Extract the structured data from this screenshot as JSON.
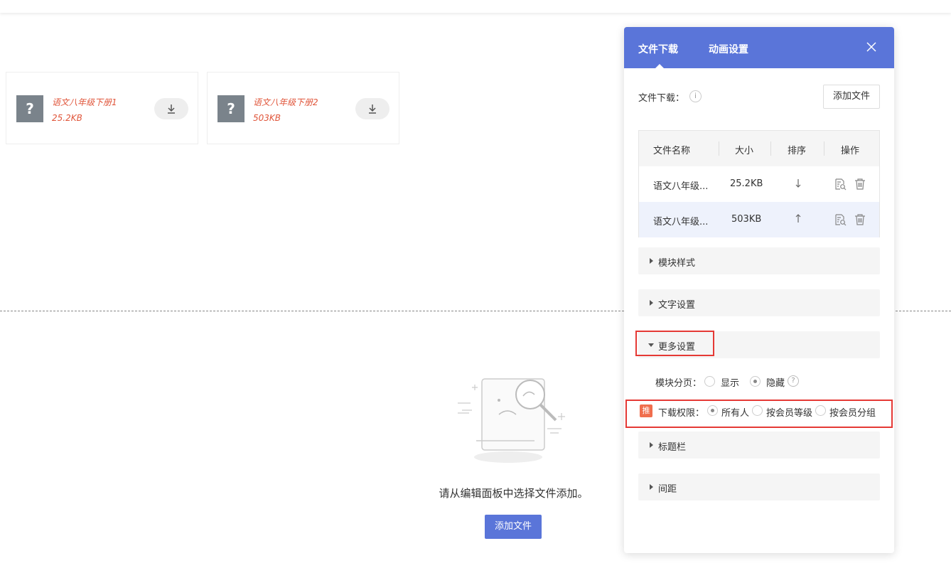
{
  "cards": [
    {
      "name": "语文八年级下册1",
      "size": "25.2KB",
      "icon": "?"
    },
    {
      "name": "语文八年级下册2",
      "size": "503KB",
      "icon": "?"
    }
  ],
  "empty": {
    "message": "请从编辑面板中选择文件添加。",
    "add_label": "添加文件"
  },
  "panel": {
    "tabs": [
      "文件下载",
      "动画设置"
    ],
    "active_tab": "文件下载",
    "file_download_label": "文件下载：",
    "info_icon": "i",
    "add_file_label": "添加文件",
    "table": {
      "headers": [
        "文件名称",
        "大小",
        "排序",
        "操作"
      ],
      "rows": [
        {
          "name": "语文八年级...",
          "size": "25.2KB",
          "sort_icon": "arrow-down-icon"
        },
        {
          "name": "语文八年级...",
          "size": "503KB",
          "sort_icon": "arrow-up-icon"
        }
      ]
    },
    "sections": {
      "module_style": "模块样式",
      "text_settings": "文字设置",
      "more_settings": "更多设置",
      "title_bar": "标题栏",
      "spacing": "间距"
    },
    "pagination": {
      "label": "模块分页：",
      "options": [
        "显示",
        "隐藏"
      ],
      "selected": "隐藏",
      "help_icon": "?"
    },
    "download_permission": {
      "badge": "推",
      "label": "下载权限：",
      "options": [
        "所有人",
        "按会员等级",
        "按会员分组"
      ],
      "selected": "所有人"
    }
  },
  "colors": {
    "accent": "#5a75d9",
    "file_text": "#e0553a",
    "highlight_box": "#e53935",
    "badge": "#f06e4d"
  }
}
